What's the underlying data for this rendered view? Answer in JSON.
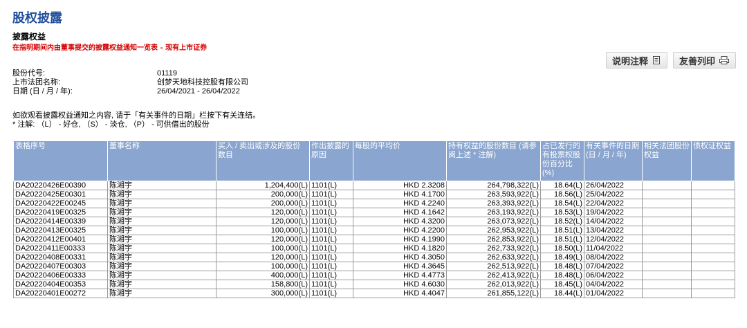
{
  "page_title": "股权披露",
  "section": {
    "title": "披露权益",
    "subtitle": "在指明期间内由董事提交的披露权益通知一览表 - 现有上市证券"
  },
  "toolbar": {
    "notes_label": "说明注释",
    "print_label": "友善列印"
  },
  "meta": {
    "stock_code_label": "股份代号:",
    "stock_code": "01119",
    "company_label": "上市法团名称:",
    "company": "创梦天地科技控股有限公司",
    "date_label": "日期 (日 / 月 / 年):",
    "date_range": "26/04/2021 - 26/04/2022"
  },
  "notes": {
    "line1": "如欲观看披露权益通知之内容, 请于「有关事件的日期」栏按下有关连结。",
    "line2": "* 注解: （L） - 好仓, （S） - 淡仓, （P） - 可供借出的股份"
  },
  "table": {
    "headers": [
      "表格序号",
      "董事名称",
      "买入 / 卖出或涉及的股份数目",
      "作出披露的原因",
      "每股的平均价",
      "持有权益的股份数目 (请参阅上述 * 注解)",
      "占已发行的有投票权股份百分比 (%)",
      "有关事件的日期 (日 / 月 / 年)",
      "相关法团股份权益",
      "债权证权益"
    ],
    "rows": [
      [
        "DA20220426E00390",
        "陈湘宇",
        "1,204,400(L)",
        "1101(L)",
        "HKD 2.3208",
        "264,798,322(L)",
        "18.64(L)",
        "26/04/2022",
        "",
        ""
      ],
      [
        "DA20220425E00301",
        "陈湘宇",
        "200,000(L)",
        "1101(L)",
        "HKD 4.1700",
        "263,593,922(L)",
        "18.56(L)",
        "25/04/2022",
        "",
        ""
      ],
      [
        "DA20220422E00245",
        "陈湘宇",
        "200,000(L)",
        "1101(L)",
        "HKD 4.2240",
        "263,393,922(L)",
        "18.54(L)",
        "22/04/2022",
        "",
        ""
      ],
      [
        "DA20220419E00325",
        "陈湘宇",
        "120,000(L)",
        "1101(L)",
        "HKD 4.1642",
        "263,193,922(L)",
        "18.53(L)",
        "19/04/2022",
        "",
        ""
      ],
      [
        "DA20220414E00339",
        "陈湘宇",
        "120,000(L)",
        "1101(L)",
        "HKD 4.3200",
        "263,073,922(L)",
        "18.52(L)",
        "14/04/2022",
        "",
        ""
      ],
      [
        "DA20220413E00325",
        "陈湘宇",
        "100,000(L)",
        "1101(L)",
        "HKD 4.2200",
        "262,953,922(L)",
        "18.51(L)",
        "13/04/2022",
        "",
        ""
      ],
      [
        "DA20220412E00401",
        "陈湘宇",
        "120,000(L)",
        "1101(L)",
        "HKD 4.1990",
        "262,853,922(L)",
        "18.51(L)",
        "12/04/2022",
        "",
        ""
      ],
      [
        "DA20220411E00333",
        "陈湘宇",
        "100,000(L)",
        "1101(L)",
        "HKD 4.1820",
        "262,733,922(L)",
        "18.50(L)",
        "11/04/2022",
        "",
        ""
      ],
      [
        "DA20220408E00331",
        "陈湘宇",
        "120,000(L)",
        "1101(L)",
        "HKD 4.3050",
        "262,633,922(L)",
        "18.49(L)",
        "08/04/2022",
        "",
        ""
      ],
      [
        "DA20220407E00303",
        "陈湘宇",
        "100,000(L)",
        "1101(L)",
        "HKD 4.3645",
        "262,513,922(L)",
        "18.48(L)",
        "07/04/2022",
        "",
        ""
      ],
      [
        "DA20220406E00333",
        "陈湘宇",
        "400,000(L)",
        "1101(L)",
        "HKD 4.4773",
        "262,413,922(L)",
        "18.48(L)",
        "06/04/2022",
        "",
        ""
      ],
      [
        "DA20220404E00353",
        "陈湘宇",
        "158,800(L)",
        "1101(L)",
        "HKD 4.6030",
        "262,013,922(L)",
        "18.45(L)",
        "04/04/2022",
        "",
        ""
      ],
      [
        "DA20220401E00272",
        "陈湘宇",
        "300,000(L)",
        "1101(L)",
        "HKD 4.4047",
        "261,855,122(L)",
        "18.44(L)",
        "01/04/2022",
        "",
        ""
      ]
    ]
  }
}
